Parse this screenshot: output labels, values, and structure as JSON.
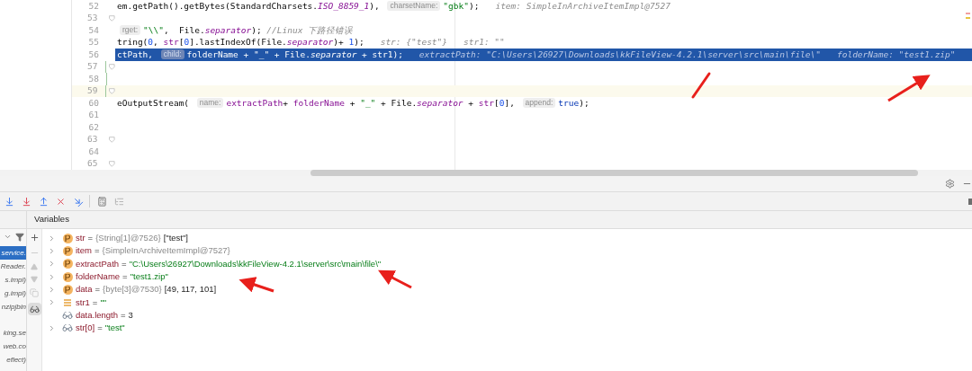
{
  "editor": {
    "lines": [
      {
        "number": "52",
        "execution_point": false,
        "caret_line": false,
        "fold": false,
        "segments": [
          {
            "kind": "plain",
            "text": "em.getPath().getBytes(StandardCharsets."
          },
          {
            "kind": "field",
            "text": "ISO_8859_1"
          },
          {
            "kind": "plain",
            "text": "), "
          },
          {
            "kind": "hint",
            "text": "charsetName:"
          },
          {
            "kind": "string",
            "text": "\"gbk\""
          },
          {
            "kind": "plain",
            "text": ");"
          },
          {
            "kind": "inline",
            "text": "item: SimpleInArchiveItemImpl@7527"
          }
        ]
      },
      {
        "number": "53",
        "execution_point": false,
        "caret_line": false,
        "fold": true
      },
      {
        "number": "54",
        "execution_point": false,
        "caret_line": false,
        "fold": false,
        "segments": [
          {
            "kind": "hint",
            "text": "rget:"
          },
          {
            "kind": "string",
            "text": "\"\\\\\""
          },
          {
            "kind": "plain",
            "text": ",  File."
          },
          {
            "kind": "field",
            "text": "separator"
          },
          {
            "kind": "plain",
            "text": "); "
          },
          {
            "kind": "comment",
            "text": "//Linux 下路径错误"
          }
        ]
      },
      {
        "number": "55",
        "execution_point": false,
        "caret_line": false,
        "fold": false,
        "segments": [
          {
            "kind": "plain",
            "text": "tring("
          },
          {
            "kind": "number",
            "text": "0"
          },
          {
            "kind": "plain",
            "text": ", "
          },
          {
            "kind": "var",
            "text": "str"
          },
          {
            "kind": "plain",
            "text": "["
          },
          {
            "kind": "number",
            "text": "0"
          },
          {
            "kind": "plain",
            "text": "].lastIndexOf(File."
          },
          {
            "kind": "field",
            "text": "separator"
          },
          {
            "kind": "plain",
            "text": ")+ "
          },
          {
            "kind": "number",
            "text": "1"
          },
          {
            "kind": "plain",
            "text": ");"
          },
          {
            "kind": "inline",
            "text": "str: {\"test\"}"
          },
          {
            "kind": "inline",
            "text": "str1: \"\""
          }
        ]
      },
      {
        "number": "56",
        "execution_point": true,
        "caret_line": false,
        "fold": false,
        "segments": [
          {
            "kind": "plain",
            "text": "ctPath, "
          },
          {
            "kind": "hint",
            "text": "child:"
          },
          {
            "kind": "plain",
            "text": "folderName + \"_\" + File."
          },
          {
            "kind": "field",
            "text": "separator"
          },
          {
            "kind": "plain",
            "text": " + str1);"
          },
          {
            "kind": "inline",
            "text": "extractPath: \"C:\\Users\\26927\\Downloads\\kkFileView-4.2.1\\server\\src\\main\\file\\\""
          },
          {
            "kind": "inline",
            "text": "folderName: \"test1.zip\""
          }
        ]
      },
      {
        "number": "57",
        "execution_point": false,
        "caret_line": false,
        "fold": true
      },
      {
        "number": "58",
        "execution_point": false,
        "caret_line": false,
        "fold": false
      },
      {
        "number": "59",
        "execution_point": false,
        "caret_line": true,
        "fold": true
      },
      {
        "number": "60",
        "execution_point": false,
        "caret_line": false,
        "fold": false,
        "segments": [
          {
            "kind": "plain",
            "text": "eOutputStream( "
          },
          {
            "kind": "hint",
            "text": "name:"
          },
          {
            "kind": "var",
            "text": "extractPath"
          },
          {
            "kind": "plain",
            "text": "+ "
          },
          {
            "kind": "var",
            "text": "folderName"
          },
          {
            "kind": "plain",
            "text": " + "
          },
          {
            "kind": "string",
            "text": "\"_\""
          },
          {
            "kind": "plain",
            "text": " + File."
          },
          {
            "kind": "field",
            "text": "separator"
          },
          {
            "kind": "plain",
            "text": " + "
          },
          {
            "kind": "var",
            "text": "str"
          },
          {
            "kind": "plain",
            "text": "["
          },
          {
            "kind": "number",
            "text": "0"
          },
          {
            "kind": "plain",
            "text": "], "
          },
          {
            "kind": "hint",
            "text": "append:"
          },
          {
            "kind": "keyword",
            "text": "true"
          },
          {
            "kind": "plain",
            "text": ");"
          }
        ]
      },
      {
        "number": "61",
        "execution_point": false,
        "caret_line": false,
        "fold": false
      },
      {
        "number": "62",
        "execution_point": false,
        "caret_line": false,
        "fold": false
      },
      {
        "number": "63",
        "execution_point": false,
        "caret_line": false,
        "fold": true
      },
      {
        "number": "64",
        "execution_point": false,
        "caret_line": false,
        "fold": false
      },
      {
        "number": "65",
        "execution_point": false,
        "caret_line": false,
        "fold": true
      }
    ]
  },
  "frames": {
    "groups": [
      [
        {
          "label": "service.",
          "selected": true
        },
        {
          "label": "Reader.",
          "selected": false
        },
        {
          "label": "s.impl)",
          "selected": false
        },
        {
          "label": "g.impl)",
          "selected": false
        },
        {
          "label": "nzipjbin",
          "selected": false
        }
      ],
      [
        {
          "label": "king.se",
          "selected": false
        },
        {
          "label": "web.co",
          "selected": false
        },
        {
          "label": "eflect)",
          "selected": false
        }
      ]
    ]
  },
  "variables": {
    "title": "Variables",
    "watches_selected": true,
    "rows": [
      {
        "kind": "field",
        "expandable": true,
        "name": "str",
        "operator": "=",
        "type_info": "{String[1]@7526}",
        "value": "[\"test\"]"
      },
      {
        "kind": "field",
        "expandable": true,
        "name": "item",
        "operator": "=",
        "type_info": "{SimpleInArchiveItemImpl@7527}"
      },
      {
        "kind": "field",
        "expandable": true,
        "name": "extractPath",
        "operator": "=",
        "string_value": "\"C:\\Users\\26927\\Downloads\\kkFileView-4.2.1\\server\\src\\main\\file\\\""
      },
      {
        "kind": "field",
        "expandable": true,
        "name": "folderName",
        "operator": "=",
        "string_value": "\"test1.zip\""
      },
      {
        "kind": "field",
        "expandable": true,
        "name": "data",
        "operator": "=",
        "type_info": "{byte[3]@7530}",
        "value": "[49, 117, 101]"
      },
      {
        "kind": "local",
        "expandable": true,
        "name": "str1",
        "operator": "=",
        "string_value": "\"\""
      },
      {
        "kind": "watch",
        "expandable": false,
        "name": "data.length",
        "operator": "=",
        "value": "3"
      },
      {
        "kind": "watch",
        "expandable": true,
        "name": "str[0]",
        "operator": "=",
        "string_value": "\"test\""
      }
    ]
  }
}
